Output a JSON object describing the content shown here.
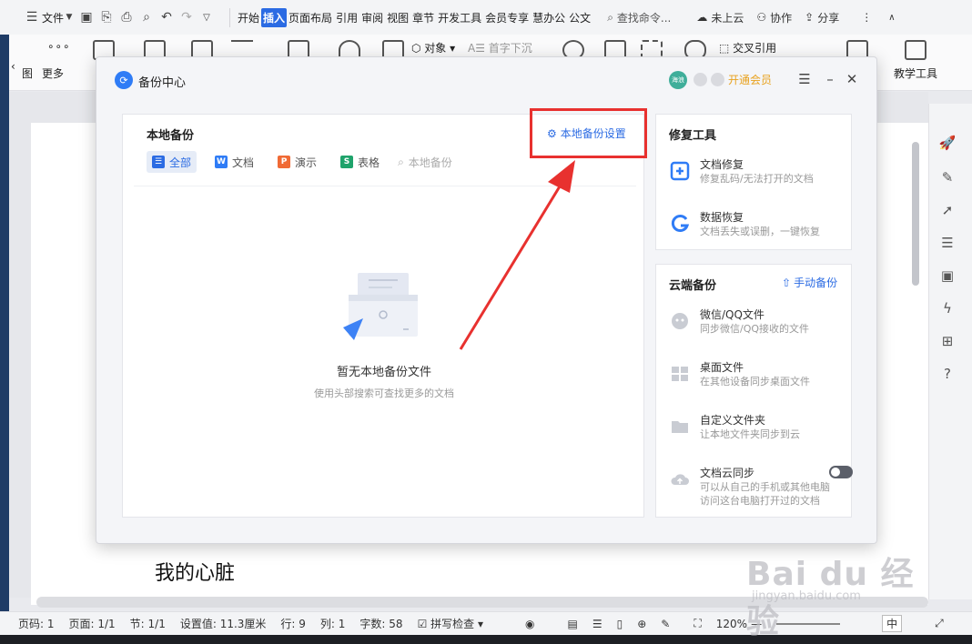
{
  "menubar": {
    "file_label": "文件",
    "tabs": [
      "开始",
      "插入",
      "页面布局",
      "引用",
      "审阅",
      "视图",
      "章节",
      "开发工具",
      "会员专享",
      "慧办公",
      "公文"
    ],
    "active_tab": "插入",
    "search_label": "查找命令...",
    "cloud_label": "未上云",
    "collab_label": "协作",
    "share_label": "分享"
  },
  "ribbon": {
    "more_label": "更多",
    "object_label": "对象",
    "dropcap_label": "首字下沉",
    "crossref_label": "交叉引用",
    "teaching_label": "教学工具",
    "left_fragment": "图"
  },
  "document": {
    "text": "我的心脏"
  },
  "dialog": {
    "title": "备份中心",
    "avatar_text": "海浪",
    "vip_label": "开通会员",
    "local": {
      "title": "本地备份",
      "settings_label": "本地备份设置",
      "filters": [
        {
          "label": "全部",
          "icon": "list-icon",
          "color": "#2b6be3"
        },
        {
          "label": "文档",
          "icon": "word-icon",
          "color": "#2f7cf6"
        },
        {
          "label": "演示",
          "icon": "ppt-icon",
          "color": "#f06a35"
        },
        {
          "label": "表格",
          "icon": "excel-icon",
          "color": "#1fa36b"
        }
      ],
      "search_placeholder": "本地备份",
      "empty_title": "暂无本地备份文件",
      "empty_subtitle": "使用头部搜索可查找更多的文档"
    },
    "repair": {
      "title": "修复工具",
      "items": [
        {
          "name": "文档修复",
          "desc": "修复乱码/无法打开的文档"
        },
        {
          "name": "数据恢复",
          "desc": "文档丢失或误删，一键恢复"
        }
      ]
    },
    "cloud": {
      "title": "云端备份",
      "manual_label": "手动备份",
      "items": [
        {
          "name": "微信/QQ文件",
          "desc": "同步微信/QQ接收的文件"
        },
        {
          "name": "桌面文件",
          "desc": "在其他设备同步桌面文件"
        },
        {
          "name": "自定义文件夹",
          "desc": "让本地文件夹同步到云"
        },
        {
          "name": "文档云同步",
          "desc": "可以从自己的手机或其他电脑",
          "desc2": "访问这台电脑打开过的文档"
        }
      ],
      "sync_enabled": false
    }
  },
  "statusbar": {
    "page_num": "页码: 1",
    "page_count": "页面: 1/1",
    "section": "节: 1/1",
    "setting": "设置值: 11.3厘米",
    "row": "行: 9",
    "col": "列: 1",
    "word_count": "字数: 58",
    "spell_check": "拼写检查",
    "zoom": "120%",
    "ime": "中"
  },
  "watermark": {
    "main": "Bai du 经验",
    "sub": "jingyan.baidu.com"
  },
  "colors": {
    "accent": "#2b6be3",
    "annotation": "#e8312f",
    "vip": "#e8a21f"
  }
}
